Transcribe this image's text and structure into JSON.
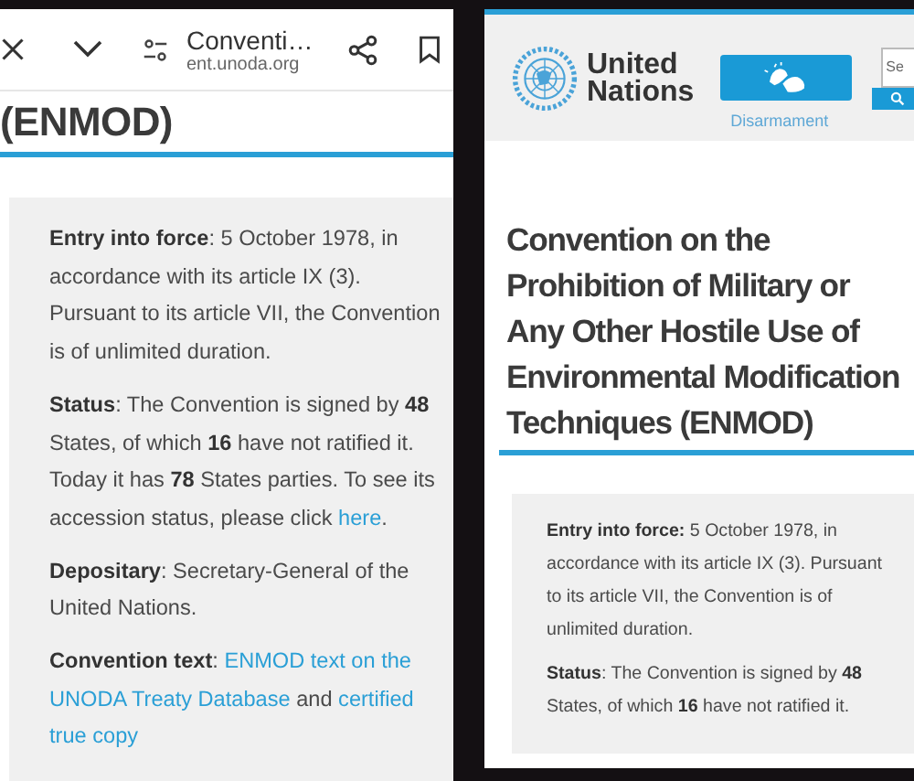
{
  "left": {
    "browser_bar": {
      "title": "Conventi…",
      "url": "ent.unoda.org"
    },
    "heading": "(ENMOD)",
    "paragraphs": [
      [
        {
          "kind": "text",
          "text": "**Entry into force**: 5 October 1978, in accordance with its article IX (3). Pursuant to its article VII, the Convention is of unlimited duration."
        }
      ],
      [
        {
          "kind": "text",
          "text": "**Status**: The Convention is signed by **48** States, of which **16** have not ratified it. Today it has **78** States parties. To see its accession status, please click "
        },
        {
          "kind": "link",
          "text": "here"
        },
        {
          "kind": "text",
          "text": "."
        }
      ],
      [
        {
          "kind": "text",
          "text": "**Depositary**: Secretary-General of the United Nations."
        }
      ],
      [
        {
          "kind": "text",
          "text": "**Convention text**: "
        },
        {
          "kind": "link",
          "text": "ENMOD text on the"
        },
        {
          "kind": "link",
          "text": "UNODA Treaty Database"
        },
        {
          "kind": "text",
          "text": " and "
        },
        {
          "kind": "link",
          "text": "certified"
        },
        {
          "kind": "link",
          "text": "true copy"
        }
      ]
    ]
  },
  "right": {
    "header": {
      "logo_lines": [
        "United",
        "Nations"
      ],
      "nav_label": "Disarmament",
      "search": {
        "placeholder": "Se"
      }
    },
    "title": "Convention on the Prohibition of Military or Any Other Hostile Use of Environmental Modification Techniques (ENMOD)",
    "paragraphs": [
      [
        {
          "kind": "text",
          "text": "**Entry into force:** 5 October 1978, in accordance with its article IX (3). Pursuant to its article VII, the Convention is of unlimited duration."
        }
      ],
      [
        {
          "kind": "text",
          "text": "**Status**: The Convention is signed by **48** States, of which **16** have not ratified it."
        }
      ]
    ]
  }
}
